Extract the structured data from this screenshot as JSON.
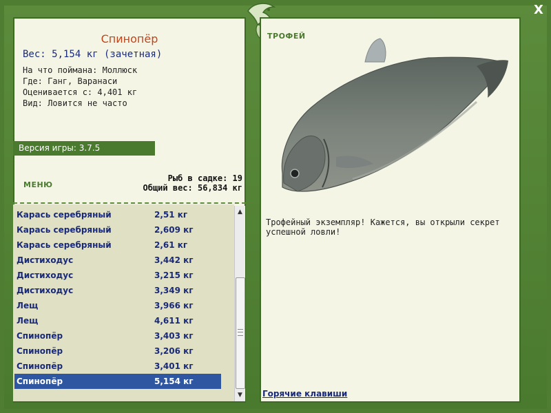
{
  "fish": {
    "name": "Спинопёр",
    "weight_line": "Вес: 5,154 кг (зачетная)",
    "caught_on": "На что поймана: Моллюск",
    "location": "Где: Ганг, Варанаси",
    "rated_from": "Оценивается с: 4,401 кг",
    "rarity": "Вид: Ловится не часто"
  },
  "version": "Версия игры: 3.7.5",
  "menu_label": "МЕНЮ",
  "stats": {
    "fish_count": "Рыб в садке: 19",
    "total_weight": "Общий вес: 56,834 кг"
  },
  "catches": [
    {
      "name": "Карась серебряный",
      "weight": "2,51 кг"
    },
    {
      "name": "Карась серебряный",
      "weight": "2,609 кг"
    },
    {
      "name": "Карась серебряный",
      "weight": "2,61 кг"
    },
    {
      "name": "Дистиходус",
      "weight": "3,442 кг"
    },
    {
      "name": "Дистиходус",
      "weight": "3,215 кг"
    },
    {
      "name": "Дистиходус",
      "weight": "3,349 кг"
    },
    {
      "name": "Лещ",
      "weight": "3,966 кг"
    },
    {
      "name": "Лещ",
      "weight": "4,611 кг"
    },
    {
      "name": "Спинопёр",
      "weight": "3,403 кг"
    },
    {
      "name": "Спинопёр",
      "weight": "3,206 кг"
    },
    {
      "name": "Спинопёр",
      "weight": "3,401 кг"
    },
    {
      "name": "Спинопёр",
      "weight": "5,154 кг"
    }
  ],
  "selected_index": 11,
  "trophy": {
    "label": "ТРОФЕЙ",
    "message": "Трофейный экземпляр! Кажется, вы открыли секрет успешной ловли!"
  },
  "hotkeys_label": "Горячие клавиши",
  "close_label": "X",
  "icons": {
    "logo": "fish-logo-icon",
    "close": "close-icon",
    "scroll_up": "arrow-up-icon",
    "scroll_down": "arrow-down-icon"
  },
  "colors": {
    "frame": "#4f7e33",
    "panel": "#f5f5e6",
    "list_bg": "#dfe0c4",
    "selected": "#2f56a0",
    "fish_name": "#c0451a",
    "text_blue": "#1a2a7a"
  }
}
